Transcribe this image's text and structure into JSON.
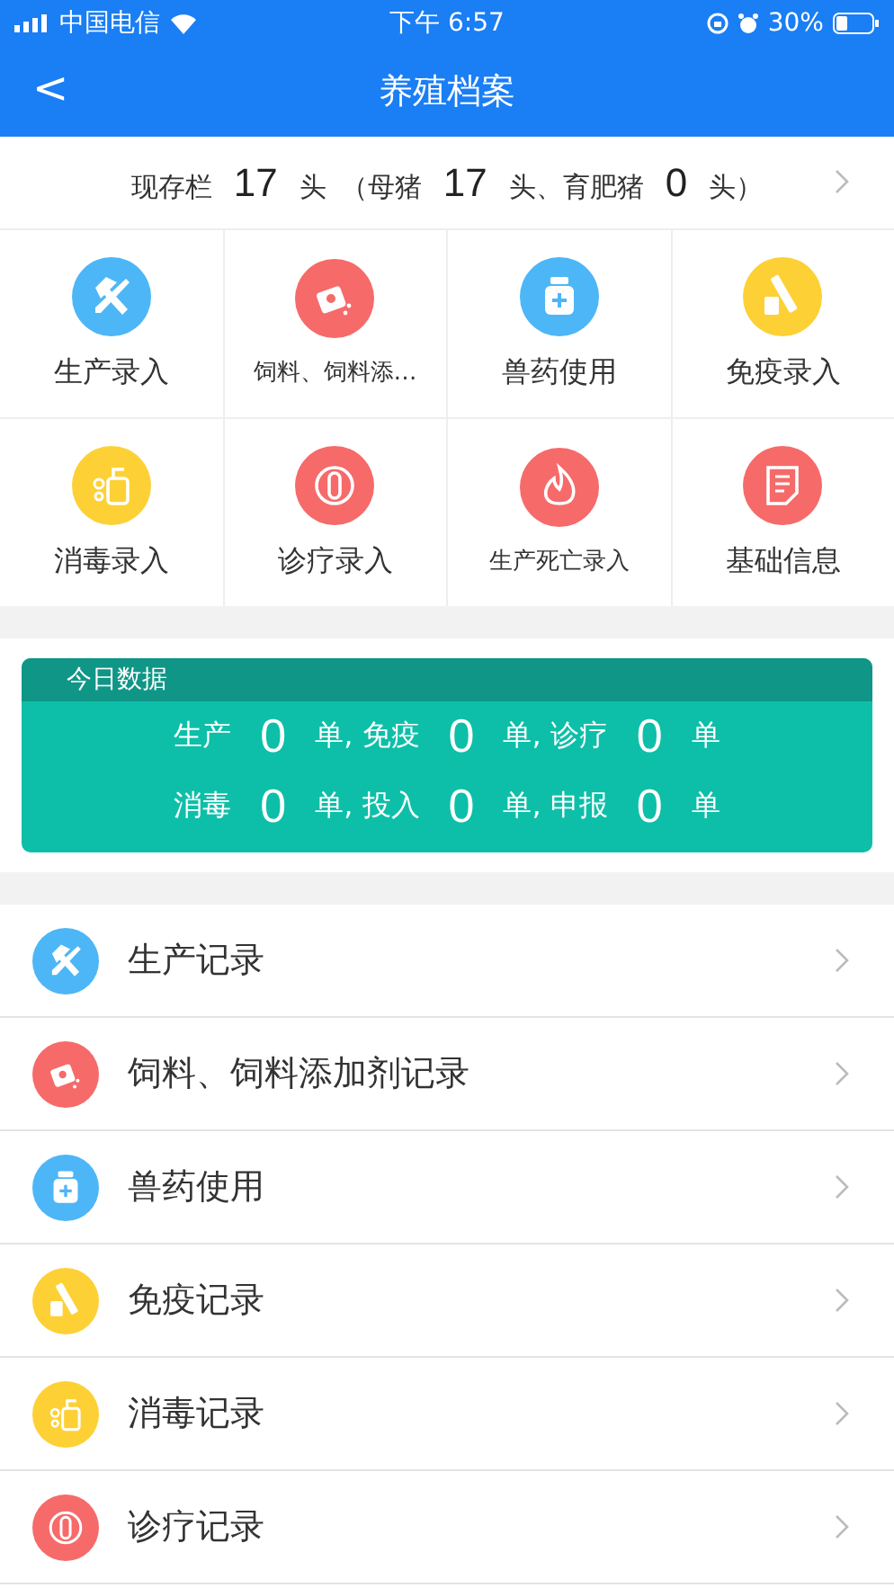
{
  "status_bar": {
    "carrier": "中国电信",
    "time": "下午 6:57",
    "battery": "30%"
  },
  "nav": {
    "back": "<",
    "title": "养殖档案"
  },
  "summary": [
    {
      "kind": "label",
      "text": "现存栏"
    },
    {
      "kind": "number",
      "text": "17"
    },
    {
      "kind": "label",
      "text": "头"
    },
    {
      "kind": "label",
      "text": "（母猪"
    },
    {
      "kind": "number",
      "text": "17"
    },
    {
      "kind": "label",
      "text": "头、育肥猪"
    },
    {
      "kind": "number",
      "text": "0"
    },
    {
      "kind": "label",
      "text": "头）"
    }
  ],
  "grid": [
    {
      "label": "生产录入",
      "kind": "tools",
      "color": "#4db6f7"
    },
    {
      "label": "饲料、饲料添…",
      "kind": "feed",
      "color": "#f66a6a"
    },
    {
      "label": "兽药使用",
      "kind": "medicine",
      "color": "#4db6f7"
    },
    {
      "label": "免疫录入",
      "kind": "vaccine",
      "color": "#fdd135"
    },
    {
      "label": "消毒录入",
      "kind": "disinfect",
      "color": "#fdd135"
    },
    {
      "label": "诊疗录入",
      "kind": "diagnosis",
      "color": "#f66a6a"
    },
    {
      "label": "生产死亡录入",
      "kind": "fire",
      "color": "#f66a6a"
    },
    {
      "label": "基础信息",
      "kind": "document",
      "color": "#f66a6a"
    }
  ],
  "today": {
    "title": "今日数据",
    "rows": [
      [
        {
          "kind": "label",
          "text": "生产"
        },
        {
          "kind": "number",
          "text": "0"
        },
        {
          "kind": "label",
          "text": "单, 免疫"
        },
        {
          "kind": "number",
          "text": "0"
        },
        {
          "kind": "label",
          "text": "单, 诊疗"
        },
        {
          "kind": "number",
          "text": "0"
        },
        {
          "kind": "label",
          "text": "单"
        }
      ],
      [
        {
          "kind": "label",
          "text": "消毒"
        },
        {
          "kind": "number",
          "text": "0"
        },
        {
          "kind": "label",
          "text": "单, 投入"
        },
        {
          "kind": "number",
          "text": "0"
        },
        {
          "kind": "label",
          "text": "单, 申报"
        },
        {
          "kind": "number",
          "text": "0"
        },
        {
          "kind": "label",
          "text": "单"
        }
      ]
    ]
  },
  "records": [
    {
      "label": "生产记录",
      "kind": "tools",
      "color": "#4db6f7"
    },
    {
      "label": "饲料、饲料添加剂记录",
      "kind": "feed",
      "color": "#f66a6a"
    },
    {
      "label": "兽药使用",
      "kind": "medicine",
      "color": "#4db6f7"
    },
    {
      "label": "免疫记录",
      "kind": "vaccine",
      "color": "#fdd135"
    },
    {
      "label": "消毒记录",
      "kind": "disinfect",
      "color": "#fdd135"
    },
    {
      "label": "诊疗记录",
      "kind": "diagnosis",
      "color": "#f66a6a"
    }
  ]
}
